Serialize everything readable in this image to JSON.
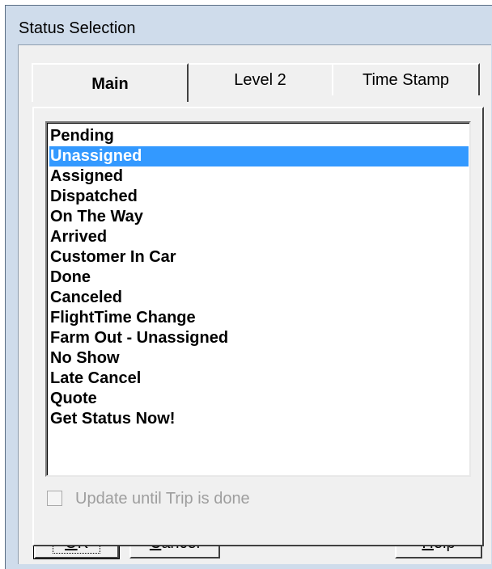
{
  "window": {
    "title": "Status Selection"
  },
  "tabs": [
    {
      "label": "Main",
      "active": true
    },
    {
      "label": "Level 2",
      "active": false
    },
    {
      "label": "Time Stamp",
      "active": false
    }
  ],
  "status_list": {
    "selected_index": 1,
    "items": [
      "Pending",
      "Unassigned",
      "Assigned",
      "Dispatched",
      "On The Way",
      "Arrived",
      "Customer In Car",
      "Done",
      "Canceled",
      "FlightTime Change",
      "Farm Out - Unassigned",
      "No Show",
      "Late Cancel",
      "Quote",
      "Get Status Now!"
    ]
  },
  "update_checkbox": {
    "label": "Update until Trip is done",
    "checked": false,
    "enabled": false
  },
  "buttons": {
    "ok": {
      "label": "OK",
      "mnemonic_char": "O",
      "rest": "K"
    },
    "cancel": {
      "label": "Cancel",
      "mnemonic_char": "C",
      "rest": "ancel"
    },
    "help": {
      "label": "Help",
      "mnemonic_char": "H",
      "rest": "elp"
    }
  },
  "colors": {
    "selection": "#3399ff",
    "window_frame": "#cfdceb",
    "face": "#f0f0f0"
  }
}
